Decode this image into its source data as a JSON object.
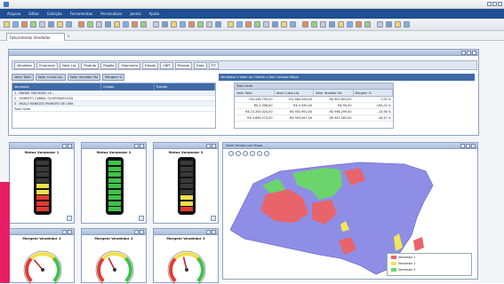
{
  "app": {
    "menu": [
      "Arquivo",
      "Editar",
      "Exibição",
      "Ferramentas",
      "Personalizar",
      "Janela",
      "Ajuda"
    ],
    "doc_tab": "Faturamento Vendedor",
    "doc_tab_close": "x"
  },
  "analysis": {
    "filters": [
      "Vendedor",
      "Empresas",
      "Valor Liq.",
      "Produto",
      "Região",
      "Segmento",
      "Estado",
      "CNPJ",
      "Período",
      "Data",
      "P/T"
    ],
    "selectors": [
      "Valor Total",
      "Valor Custo Liq.",
      "Valor Vendido Vts",
      "Margem %"
    ],
    "grid_headers": [
      "Vendedor",
      "Cidade",
      "Estado"
    ],
    "grid_rows": [
      "1 - RAFAEL MACHADO LE...",
      "2 - ROBERTO CABRAL OLIVEIRA/SOUZA",
      "3 - PAULO MENEZES PINHEIRO DE LIMA",
      "Total Geral"
    ],
    "measures_title": "Vendedor x Valor ou Cliente x Dos Campos Mapa",
    "measures_group": "Total Geral",
    "measure_headers": [
      "Valor Total",
      "Valor Custo Liq.",
      "Valor Vendido Vts",
      "Margem %"
    ],
    "measure_rows": [
      [
        "702.438.795,00",
        "702.584.098,00",
        "R$ 902.893,00",
        "-7,00 %"
      ],
      [
        "R$ 0.398,00",
        "R$ 0.590,00",
        "R$ 93,00",
        "-100,00 %"
      ],
      [
        "R$ 23.200.024,00",
        "R$ 903.992,00",
        "R$ 998.299,00",
        "-15,98 %"
      ],
      [
        "R$ 4.895.273,00",
        "R$ 903.567,00",
        "R$ 902.265,00",
        "-16,47 %"
      ]
    ]
  },
  "gauges": {
    "bar_titles": [
      "Metas Vendedor 1",
      "Metas Vendedor 2",
      "Metas Vendedor 3"
    ],
    "dial_titles": [
      "Margem Vendedor 1",
      "Margem Vendedor 2",
      "Margem Vendedor 3"
    ],
    "bar_levels": [
      0.55,
      0.95,
      0.35
    ],
    "dial_levels": [
      0.35,
      0.4,
      0.45
    ]
  },
  "map": {
    "title": "Nível Vendas por Mapa",
    "legend": [
      {
        "label": "Vendedor 1",
        "color": "#e8646a"
      },
      {
        "label": "Vendedor 2",
        "color": "#f2e65a"
      },
      {
        "label": "Vendedor 3",
        "color": "#6bd46b"
      }
    ]
  },
  "colors": {
    "menubar": "#1f4e91",
    "accent_pink": "#e81e63",
    "map_base": "#8e8ee6"
  }
}
